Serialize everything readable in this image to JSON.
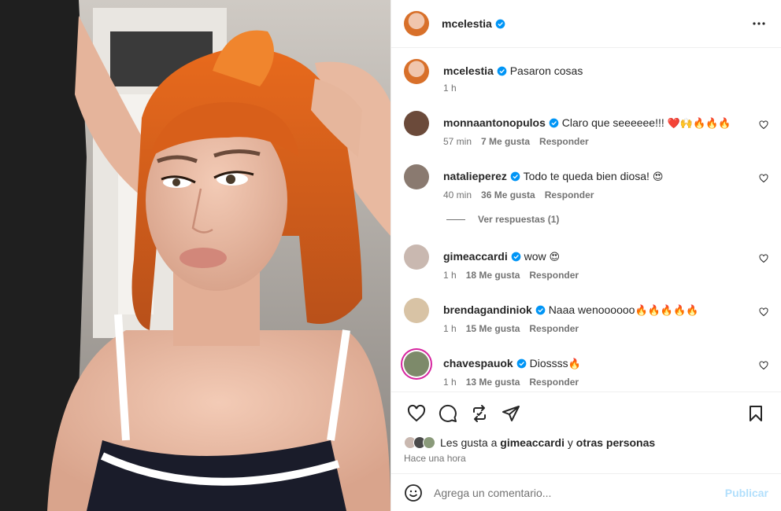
{
  "post": {
    "author": "mcelestia",
    "caption": "Pasaron cosas",
    "caption_time": "1 h"
  },
  "comments": [
    {
      "user": "monnaantonopulos",
      "text": "Claro que seeeeee!!!",
      "emoji": "❤️🙌🔥🔥🔥",
      "time": "57 min",
      "likes": "7 Me gusta",
      "reply": "Responder",
      "avatar_color": "#6b4a3a"
    },
    {
      "user": "natalieperez",
      "text": "Todo te queda bien diosa!",
      "emoji": "😍",
      "time": "40 min",
      "likes": "36 Me gusta",
      "reply": "Responder",
      "avatar_color": "#8a7a70"
    },
    {
      "user": "gimeaccardi",
      "text": "wow",
      "emoji": "😍",
      "time": "1 h",
      "likes": "18 Me gusta",
      "reply": "Responder",
      "avatar_color": "#c9b8b0"
    },
    {
      "user": "brendagandiniok",
      "text": "Naaa wenoooooo",
      "emoji": "🔥🔥🔥🔥🔥",
      "time": "1 h",
      "likes": "15 Me gusta",
      "reply": "Responder",
      "avatar_color": "#d8c3a5"
    },
    {
      "user": "chavespauok",
      "text": "Diossss",
      "emoji": "🔥",
      "time": "1 h",
      "likes": "13 Me gusta",
      "reply": "Responder",
      "avatar_color": "#7d8a6a"
    }
  ],
  "replies_link": "Ver respuestas (1)",
  "likes_summary": {
    "prefix": "Les gusta a",
    "user": "gimeaccardi",
    "conj": "y",
    "rest": "otras personas"
  },
  "posted_ago": "Hace una hora",
  "add_comment": {
    "placeholder": "Agrega un comentario...",
    "publish": "Publicar"
  },
  "icons": [
    "heart-icon",
    "comment-icon",
    "share-icon",
    "send-icon",
    "bookmark-icon",
    "more-icon",
    "verified-icon",
    "emoji-icon"
  ],
  "colors": {
    "verified": "#0095f6",
    "publish_disabled": "#b2dffc",
    "meta_text": "#737373"
  }
}
